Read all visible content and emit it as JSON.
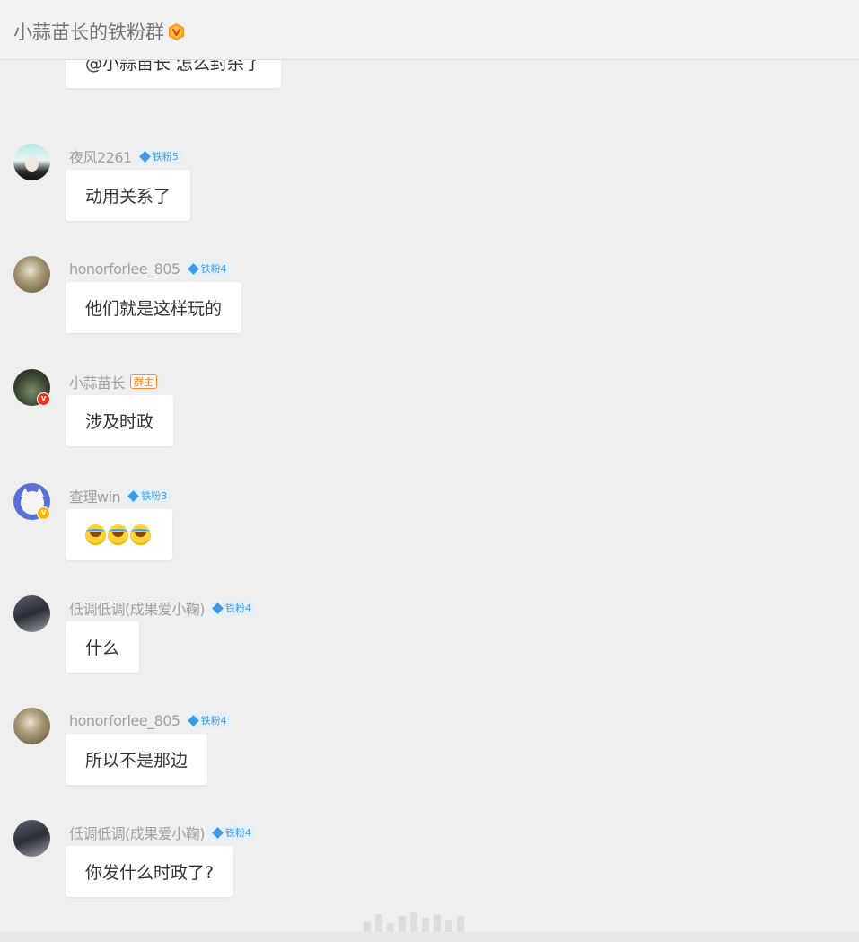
{
  "header": {
    "title": "小蒜苗长的铁粉群",
    "badge_icon": "v-vip-icon"
  },
  "colors": {
    "fan_badge": "#3e9ae6",
    "owner_badge": "#ff7a14",
    "bubble": "#ffffff",
    "background": "#efefef"
  },
  "messages": [
    {
      "text": "@小蒜苗长 怎么封杀了"
    },
    {
      "user": "夜风2261",
      "badge": "铁粉5",
      "text": "动用关系了"
    },
    {
      "user": "honorforlee_805",
      "badge": "铁粉4",
      "text": "他们就是这样玩的"
    },
    {
      "user": "小蒜苗长",
      "owner_badge": "群主",
      "text": "涉及时政"
    },
    {
      "user": "查理win",
      "badge": "铁粉3",
      "emoji": "laugh-cry-emoji"
    },
    {
      "user": "低调低调(成果爱小鞠)",
      "badge": "铁粉4",
      "text": "什么"
    },
    {
      "user": "honorforlee_805",
      "badge": "铁粉4",
      "text": "所以不是那边"
    },
    {
      "user": "低调低调(成果爱小鞠)",
      "badge": "铁粉4",
      "text": "你发什么时政了?"
    }
  ]
}
